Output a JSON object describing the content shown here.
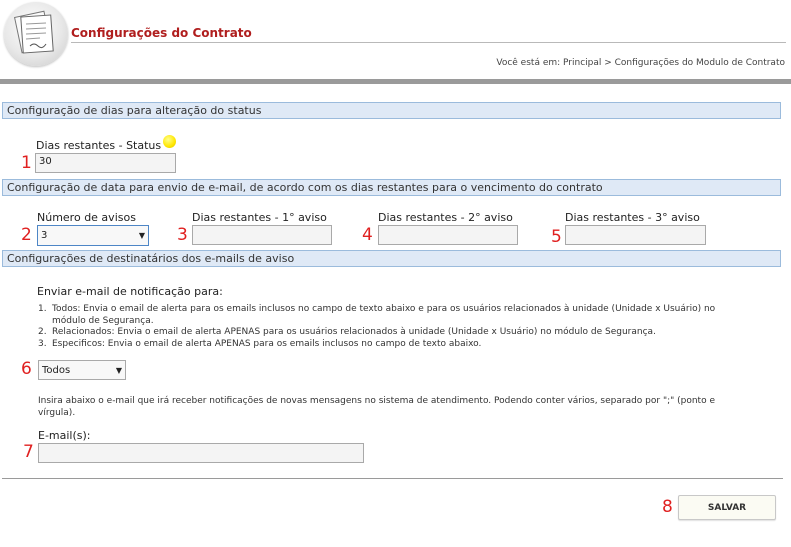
{
  "header": {
    "title": "Configurações do Contrato",
    "breadcrumb": "Você está em: Principal > Configurações do Modulo de Contrato"
  },
  "section_status": {
    "heading": "Configuração de dias para alteração do status",
    "field_label": "Dias restantes - Status",
    "field_value": "30",
    "status_icon": "yellow-status-circle-icon"
  },
  "section_email_dates": {
    "heading": "Configuração de data para envio de e-mail, de acordo com os dias restantes para o vencimento do contrato",
    "avisos_label": "Número de avisos",
    "avisos_value": "3",
    "aviso1_label": "Dias restantes - 1° aviso",
    "aviso1_value": "",
    "aviso2_label": "Dias restantes - 2° aviso",
    "aviso2_value": "",
    "aviso3_label": "Dias restantes - 3° aviso",
    "aviso3_value": ""
  },
  "section_recipients": {
    "heading": "Configurações de destinatários dos e-mails de aviso",
    "intro": "Enviar e-mail de notificação para:",
    "options_text": [
      "Todos: Envia o email de alerta para os emails inclusos no campo de texto abaixo e para os usuários relacionados à unidade (Unidade x Usuário) no",
      "módulo de Segurança.",
      "Relacionados: Envia o email de alerta APENAS para os usuários relacionados à unidade (Unidade x Usuário) no módulo de Segurança.",
      "Especificos: Envia o email de alerta APENAS para os emails inclusos no campo de texto abaixo."
    ],
    "option_numbers": [
      "1.",
      "2.",
      "3."
    ],
    "recipient_select_value": "Todos",
    "help_line1": "Insira abaixo o e-mail que irá receber notificações de novas mensagens no sistema de atendimento. Podendo conter vários, separado por \";\" (ponto e",
    "help_line2": "vírgula).",
    "email_label": "E-mail(s):",
    "email_value": ""
  },
  "markers": [
    "1",
    "2",
    "3",
    "4",
    "5",
    "6",
    "7",
    "8"
  ],
  "actions": {
    "save_label": "SALVAR"
  },
  "colors": {
    "title_red": "#b01e1e",
    "section_bg": "#dfe9f6",
    "section_border": "#9bbbdc",
    "marker_red": "#e02020"
  }
}
